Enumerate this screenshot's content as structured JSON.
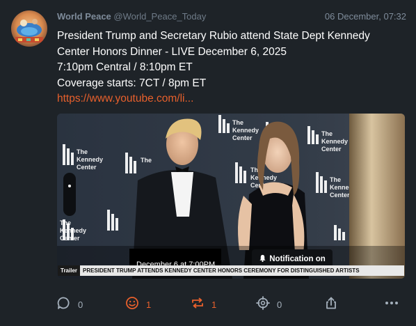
{
  "post": {
    "author_name": "World Peace",
    "handle": "@World_Peace_Today",
    "timestamp": "06 December, 07:32",
    "lines": [
      "President Trump and Secretary Rubio attend State Dept Kennedy",
      "Center Honors Dinner - LIVE December 6, 2025",
      "7:10pm Central / 8:10pm ET",
      "Coverage starts: 7CT / 8pm ET"
    ],
    "link": "https://www.youtube.com/li..."
  },
  "media": {
    "scheduled_text": "December 6 at 7:00PM",
    "notification_label": "Notification on",
    "ticker_tag": "Trailer",
    "ticker_headline": "PRESIDENT TRUMP ATTENDS KENNEDY CENTER HONORS CEREMONY FOR DISTINGUISHED ARTISTS",
    "backdrop_logo": "The Kennedy Center"
  },
  "actions": {
    "reply_count": "0",
    "like_count": "1",
    "repost_count": "1",
    "bookmark_count": "0"
  },
  "colors": {
    "background": "#1e2328",
    "accent": "#e8602c",
    "muted": "#7f8c9b"
  },
  "icons": [
    "reply-icon",
    "smile-icon",
    "repost-icon",
    "target-icon",
    "share-icon",
    "more-icon",
    "bell-icon"
  ]
}
